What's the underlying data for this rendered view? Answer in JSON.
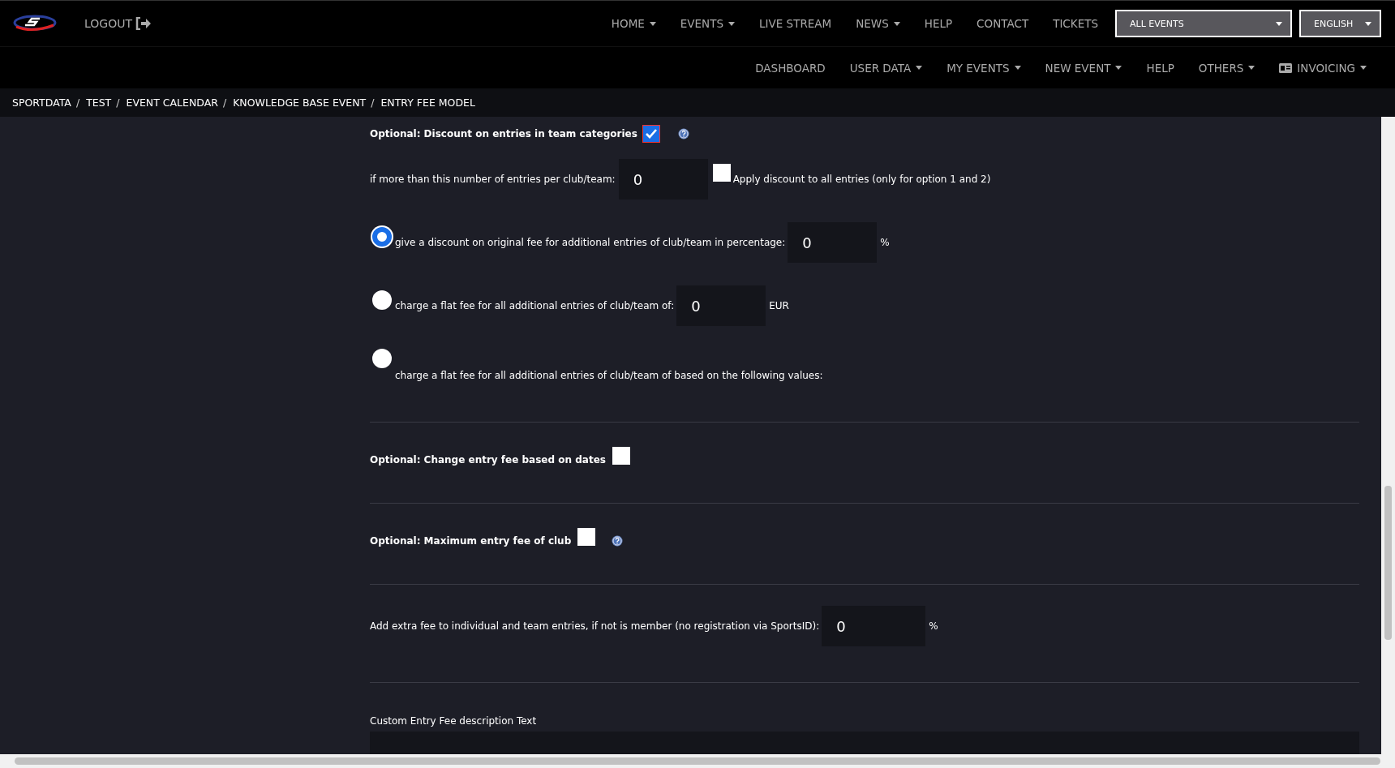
{
  "header": {
    "logout": "LOGOUT",
    "nav": [
      {
        "label": "HOME",
        "dropdown": true
      },
      {
        "label": "EVENTS",
        "dropdown": true
      },
      {
        "label": "LIVE STREAM",
        "dropdown": false
      },
      {
        "label": "NEWS",
        "dropdown": true
      },
      {
        "label": "HELP",
        "dropdown": false
      },
      {
        "label": "CONTACT",
        "dropdown": false
      },
      {
        "label": "TICKETS",
        "dropdown": false
      }
    ],
    "event_select": "ALL EVENTS",
    "language_select": "ENGLISH"
  },
  "subnav": [
    {
      "label": "DASHBOARD",
      "dropdown": false,
      "kind": "link"
    },
    {
      "label": "USER DATA",
      "dropdown": true,
      "kind": "link"
    },
    {
      "label": "MY EVENTS",
      "dropdown": true,
      "kind": "link"
    },
    {
      "label": "NEW EVENT",
      "dropdown": true,
      "kind": "link"
    },
    {
      "label": "HELP",
      "dropdown": false,
      "kind": "link"
    },
    {
      "label": "OTHERS",
      "dropdown": true,
      "kind": "link"
    },
    {
      "label": "INVOICING",
      "dropdown": true,
      "kind": "icon-link"
    }
  ],
  "breadcrumb": [
    {
      "kind": "link",
      "label": "SPORTDATA"
    },
    {
      "kind": "separator",
      "label": "/"
    },
    {
      "kind": "link",
      "label": "TEST"
    },
    {
      "kind": "separator",
      "label": "/"
    },
    {
      "kind": "link",
      "label": "EVENT CALENDAR"
    },
    {
      "kind": "separator",
      "label": "/"
    },
    {
      "kind": "link",
      "label": "KNOWLEDGE BASE EVENT"
    },
    {
      "kind": "separator",
      "label": "/"
    },
    {
      "kind": "link",
      "label": "ENTRY FEE MODEL"
    }
  ],
  "team_discount": {
    "title": "Optional: Discount on entries in team categories",
    "checked": true,
    "threshold_label": "if more than this number of entries per club/team:",
    "threshold_value": "0",
    "apply_all": {
      "label": "Apply discount to all entries (only for option 1 and 2)",
      "checked": false
    },
    "options": [
      {
        "label": "give a discount on original fee for additional entries of club/team in percentage:",
        "selected": true,
        "value": "0",
        "unit": "%"
      },
      {
        "label": "charge a flat fee for all additional entries of club/team of:",
        "selected": false,
        "value": "0",
        "unit": "EUR"
      },
      {
        "label": "charge a flat fee for all additional entries of club/team of based on the following values:",
        "selected": false
      }
    ]
  },
  "date_change": {
    "title": "Optional: Change entry fee based on dates",
    "checked": false
  },
  "max_fee": {
    "title": "Optional: Maximum entry fee of club",
    "checked": false
  },
  "extra_fee": {
    "label": "Add extra fee to individual and team entries, if not is member (no registration via SportsID):",
    "value": "0",
    "unit": "%"
  },
  "description": {
    "label": "Custom Entry Fee description Text"
  }
}
